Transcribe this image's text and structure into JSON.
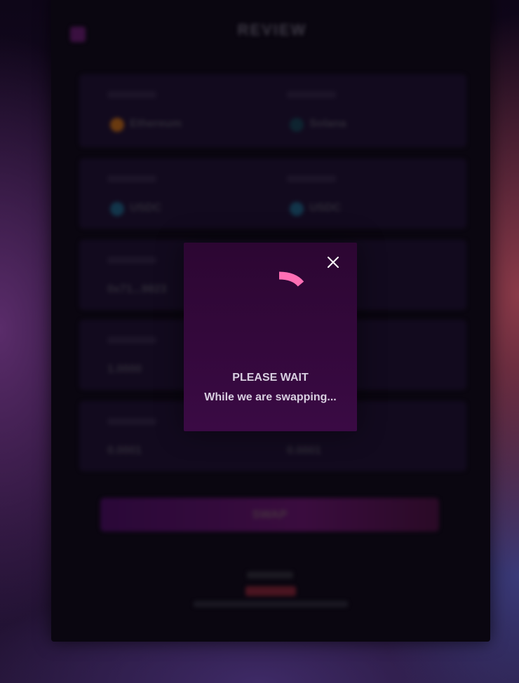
{
  "page": {
    "title": "REVIEW",
    "back_icon": "arrow-left-icon"
  },
  "form": {
    "rows": [
      {
        "left": {
          "value": "Ethereum",
          "token_color": "#6a3a10"
        },
        "right": {
          "value": "Solana",
          "token_color": "#0e2430"
        }
      },
      {
        "left": {
          "value": "USDC",
          "token_color": "#12354a"
        },
        "right": {
          "value": "USDC",
          "token_color": "#12354a"
        }
      },
      {
        "left": {
          "value": "0x71...9823"
        },
        "right": {
          "value": ""
        }
      },
      {
        "left": {
          "value": "1.0000"
        },
        "right": {
          "value": ""
        }
      },
      {
        "left": {
          "value": "0.0001"
        },
        "right": {
          "value": "0.0001"
        }
      }
    ],
    "submit_label": "SWAP"
  },
  "modal": {
    "title": "PLEASE WAIT",
    "message": "While we are swapping...",
    "close_icon": "close-icon",
    "spinner_color": "#ff6fb5"
  }
}
